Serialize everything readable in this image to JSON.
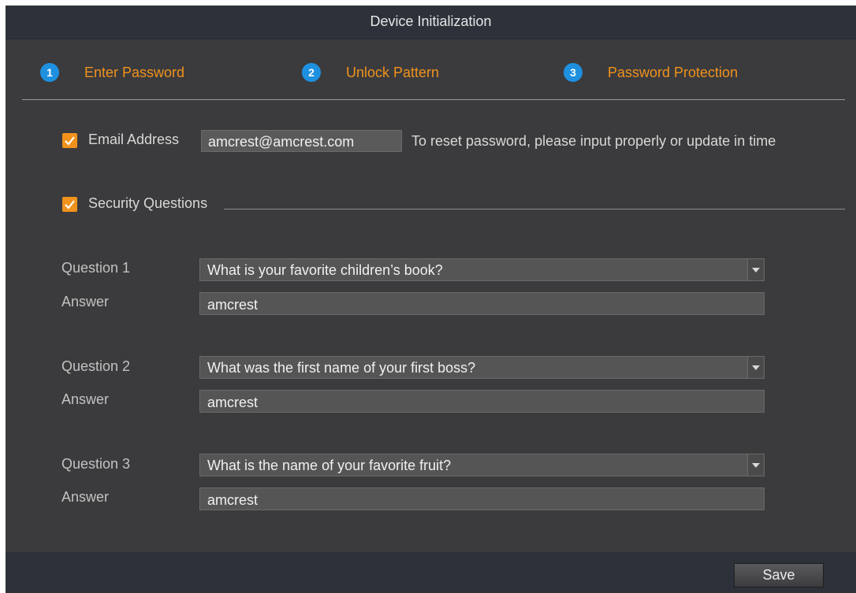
{
  "window": {
    "title": "Device Initialization"
  },
  "steps": [
    {
      "number": "1",
      "label": "Enter Password"
    },
    {
      "number": "2",
      "label": "Unlock Pattern"
    },
    {
      "number": "3",
      "label": "Password Protection"
    }
  ],
  "email": {
    "label": "Email Address",
    "value": "amcrest@amcrest.com",
    "hint": "To reset password, please input properly or update in time",
    "checked": true
  },
  "security": {
    "label": "Security Questions",
    "checked": true,
    "questions": [
      {
        "label": "Question 1",
        "selected": "What is your favorite children’s book?",
        "answer_label": "Answer",
        "answer": "amcrest"
      },
      {
        "label": "Question 2",
        "selected": "What was the first name of your first boss?",
        "answer_label": "Answer",
        "answer": "amcrest"
      },
      {
        "label": "Question 3",
        "selected": "What is the name of your favorite fruit?",
        "answer_label": "Answer",
        "answer": "amcrest"
      }
    ]
  },
  "footer": {
    "save_label": "Save"
  },
  "colors": {
    "accent": "#f0921c",
    "step_badge": "#1e90e0",
    "panel": "#3b3b3d",
    "bar": "#2d323a"
  },
  "icons": {
    "checkbox": "checkmark-icon",
    "dropdown": "chevron-down-icon"
  }
}
